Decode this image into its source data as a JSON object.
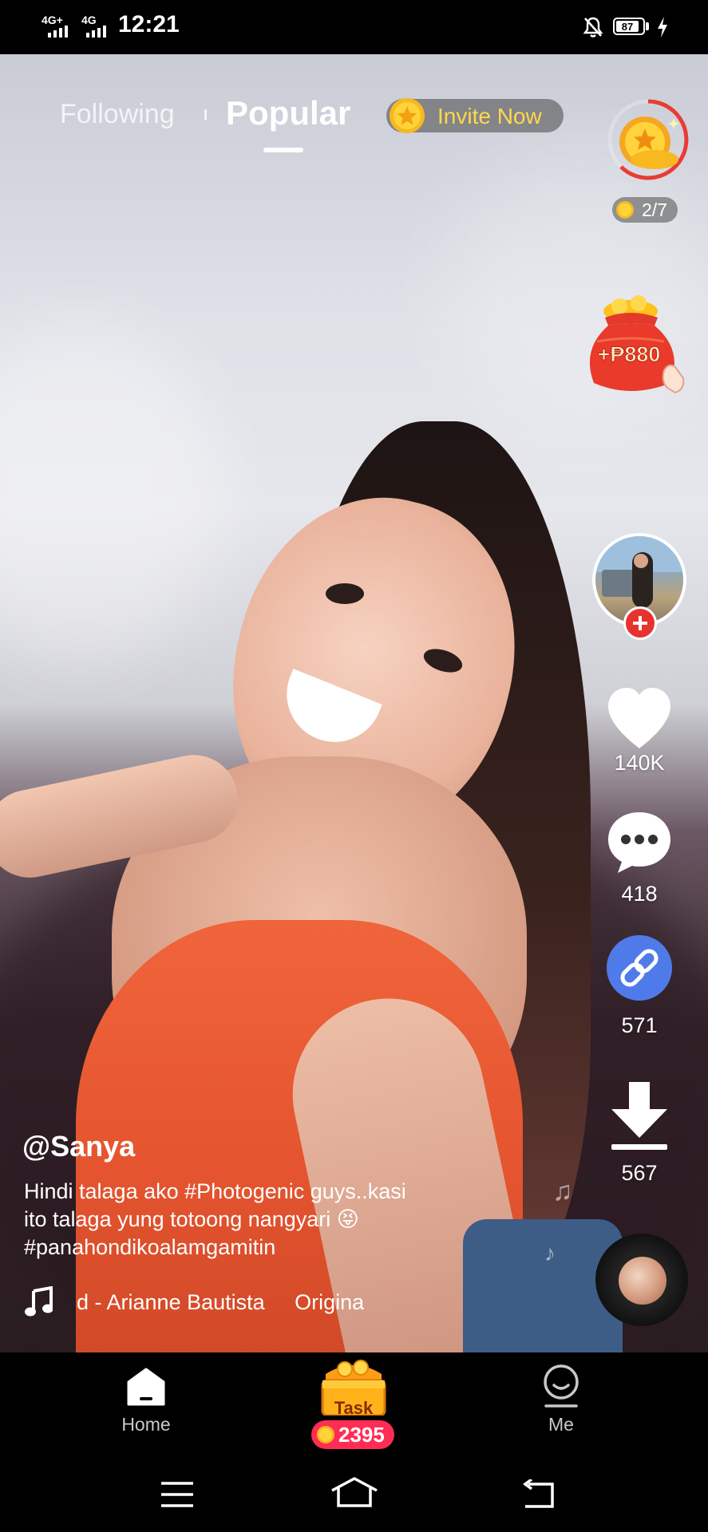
{
  "status_bar": {
    "signal_1": "4G+",
    "signal_2": "4G",
    "time": "12:21",
    "battery": "87"
  },
  "top_tabs": {
    "following": "Following",
    "popular": "Popular",
    "active": "Popular"
  },
  "invite": {
    "label": "Invite Now"
  },
  "reward": {
    "progress": "2/7"
  },
  "red_bag": {
    "amount": "+₱880"
  },
  "actions": {
    "likes": "140K",
    "comments": "418",
    "shares": "571",
    "downloads": "567"
  },
  "post": {
    "username": "@Sanya",
    "caption_line_1": "Hindi talaga ako #Photogenic guys..kasi",
    "caption_line_2": "ito talaga yung totoong nangyari 😝",
    "caption_line_3": "#panahondikoalamgamitin",
    "music_track": "d - Arianne Bautista     Origina"
  },
  "bottom_nav": {
    "home": "Home",
    "task": "Task",
    "task_coins": "2395",
    "me": "Me"
  },
  "colors": {
    "accent_red": "#e8322e",
    "share_blue": "#4f7bea",
    "invite_gold": "#ffd84d",
    "task_pink": "#ff2d55"
  },
  "icons": [
    "signal-icon",
    "mute-icon",
    "battery-icon",
    "charging-icon",
    "coin-icon",
    "heart-icon",
    "comment-icon",
    "link-icon",
    "download-icon",
    "music-note-icon",
    "home-icon",
    "person-icon",
    "treasure-chest-icon",
    "menu-icon",
    "home-outline-icon",
    "back-icon"
  ]
}
